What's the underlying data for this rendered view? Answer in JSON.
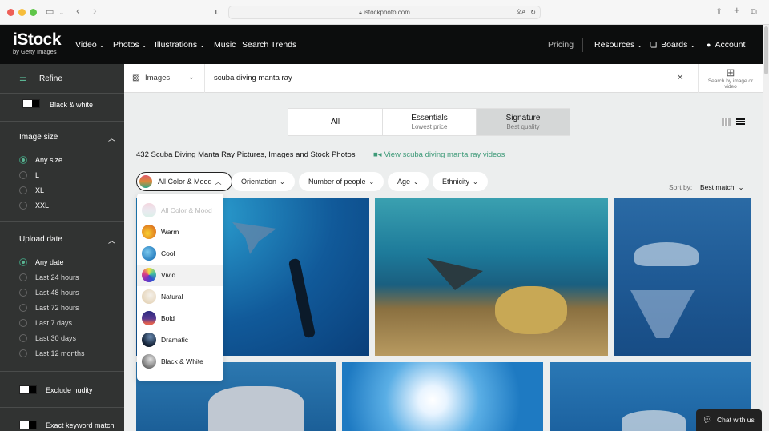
{
  "browser": {
    "url": "istockphoto.com",
    "icons": [
      "sidebar-icon",
      "chevron-down-icon",
      "back-icon",
      "forward-icon",
      "shield-icon",
      "lock-icon",
      "translate-icon",
      "reload-icon",
      "share-icon",
      "new-tab-icon",
      "tabs-icon"
    ]
  },
  "nav": {
    "logo_main": "iStock",
    "logo_sub": "by Getty Images",
    "items": [
      {
        "label": "Video",
        "dropdown": true
      },
      {
        "label": "Photos",
        "dropdown": true
      },
      {
        "label": "Illustrations",
        "dropdown": true
      },
      {
        "label": "Music",
        "dropdown": false
      },
      {
        "label": "Search Trends",
        "dropdown": false
      }
    ],
    "right": {
      "pricing": "Pricing",
      "resources": "Resources",
      "boards": "Boards",
      "account": "Account"
    }
  },
  "sidebar": {
    "refine": "Refine",
    "black_white": "Black & white",
    "image_size": {
      "title": "Image size",
      "options": [
        "Any size",
        "L",
        "XL",
        "XXL"
      ],
      "selected": "Any size"
    },
    "upload_date": {
      "title": "Upload date",
      "options": [
        "Any date",
        "Last 24 hours",
        "Last 48 hours",
        "Last 72 hours",
        "Last 7 days",
        "Last 30 days",
        "Last 12 months"
      ],
      "selected": "Any date"
    },
    "exclude_nudity": "Exclude nudity",
    "exact_keyword": "Exact keyword match"
  },
  "search": {
    "type": "Images",
    "query": "scuba diving manta ray",
    "search_by_image": "Search by image or video"
  },
  "segments": [
    {
      "title": "All",
      "sub": ""
    },
    {
      "title": "Essentials",
      "sub": "Lowest price"
    },
    {
      "title": "Signature",
      "sub": "Best quality"
    }
  ],
  "results": {
    "count_text": "432 Scuba Diving Manta Ray Pictures, Images and Stock Photos",
    "video_link": "View scuba diving manta ray videos"
  },
  "filters": [
    "All Color & Mood",
    "Orientation",
    "Number of people",
    "Age",
    "Ethnicity"
  ],
  "sort": {
    "label": "Sort by:",
    "value": "Best match"
  },
  "color_mood": {
    "options": [
      "All Color & Mood",
      "Warm",
      "Cool",
      "Vivid",
      "Natural",
      "Bold",
      "Dramatic",
      "Black & White"
    ],
    "hovered": "Vivid"
  },
  "chat": "Chat with us",
  "colors": {
    "accent_green": "#3e9a78",
    "nav_bg": "#0c0d0d",
    "sidebar_bg": "#313332"
  }
}
